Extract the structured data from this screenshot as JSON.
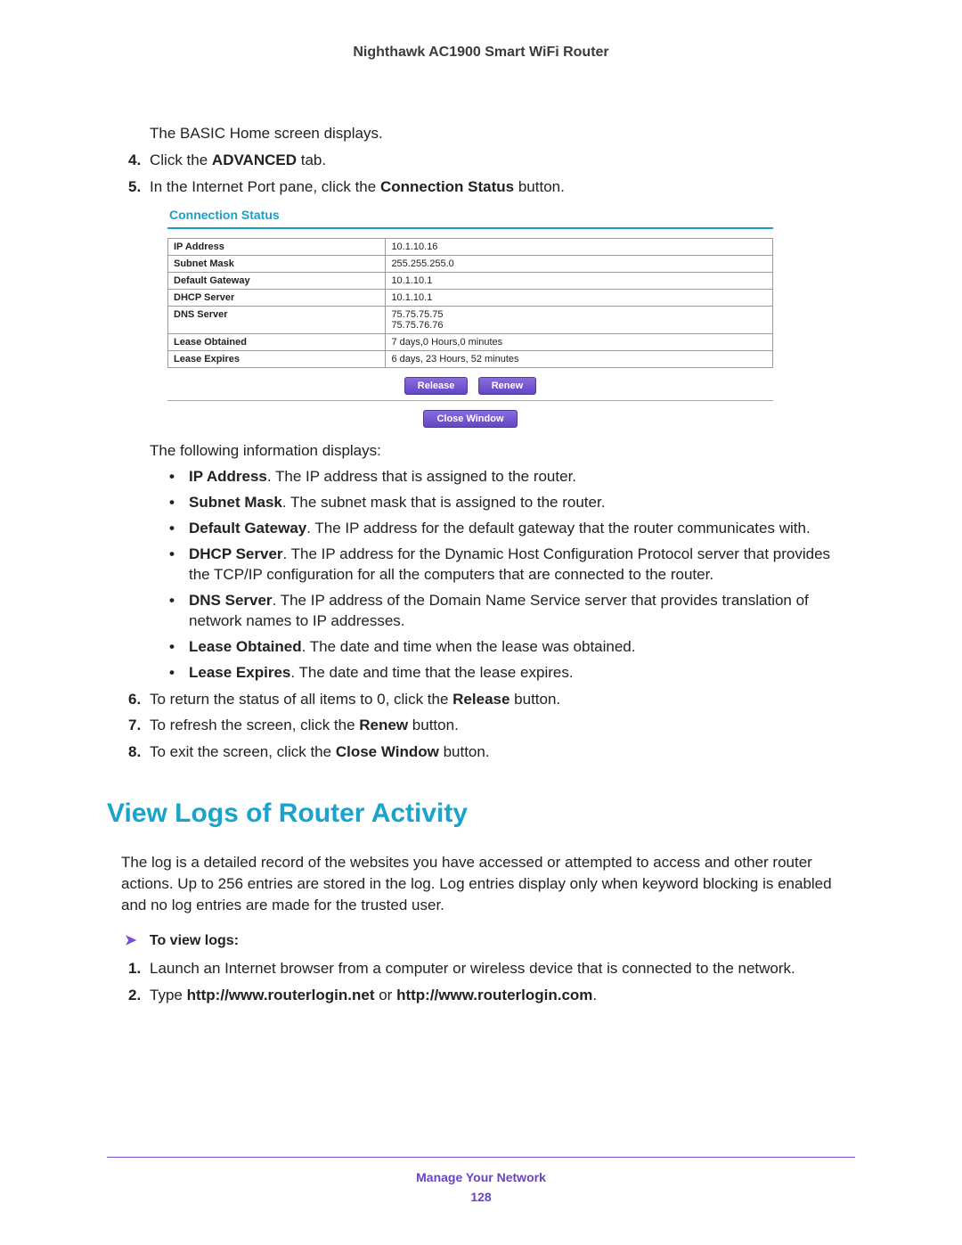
{
  "doc_title": "Nighthawk AC1900 Smart WiFi Router",
  "intro_line": "The BASIC Home screen displays.",
  "steps_a": [
    {
      "n": "4.",
      "pre": "Click the ",
      "bold": "ADVANCED",
      "post": " tab."
    },
    {
      "n": "5.",
      "pre": "In the Internet Port pane, click the ",
      "bold": "Connection Status",
      "post": " button."
    }
  ],
  "panel": {
    "title": "Connection Status",
    "rows": [
      {
        "label": "IP Address",
        "value": "10.1.10.16"
      },
      {
        "label": "Subnet Mask",
        "value": "255.255.255.0"
      },
      {
        "label": "Default Gateway",
        "value": "10.1.10.1"
      },
      {
        "label": "DHCP Server",
        "value": "10.1.10.1"
      },
      {
        "label": "DNS Server",
        "value": "75.75.75.75\n75.75.76.76"
      },
      {
        "label": "Lease Obtained",
        "value": "7 days,0 Hours,0 minutes"
      },
      {
        "label": "Lease Expires",
        "value": "6 days, 23 Hours, 52 minutes"
      }
    ],
    "buttons": {
      "release": "Release",
      "renew": "Renew",
      "close": "Close Window"
    }
  },
  "following_line": "The following information displays:",
  "bullets": [
    {
      "bold": "IP Address",
      "text": ". The IP address that is assigned to the router."
    },
    {
      "bold": "Subnet Mask",
      "text": ". The subnet mask that is assigned to the router."
    },
    {
      "bold": "Default Gateway",
      "text": ". The IP address for the default gateway that the router communicates with."
    },
    {
      "bold": "DHCP Server",
      "text": ". The IP address for the Dynamic Host Configuration Protocol server that provides the TCP/IP configuration for all the computers that are connected to the router."
    },
    {
      "bold": "DNS Server",
      "text": ". The IP address of the Domain Name Service server that provides translation of network names to IP addresses."
    },
    {
      "bold": "Lease Obtained",
      "text": ". The date and time when the lease was obtained."
    },
    {
      "bold": "Lease Expires",
      "text": ". The date and time that the lease expires."
    }
  ],
  "steps_b": [
    {
      "n": "6.",
      "pre": "To return the status of all items to 0, click the ",
      "bold": "Release",
      "post": " button."
    },
    {
      "n": "7.",
      "pre": "To refresh the screen, click the ",
      "bold": "Renew",
      "post": " button."
    },
    {
      "n": "8.",
      "pre": "To exit the screen, click the ",
      "bold": "Close Window",
      "post": " button."
    }
  ],
  "section_heading": "View Logs of Router Activity",
  "section_intro": "The log is a detailed record of the websites you have accessed or attempted to access and other router actions. Up to 256 entries are stored in the log. Log entries display only when keyword blocking is enabled and no log entries are made for the trusted user.",
  "subhead": "To view logs:",
  "steps_c": [
    {
      "n": "1.",
      "text": "Launch an Internet browser from a computer or wireless device that is connected to the network."
    },
    {
      "n": "2.",
      "pre": "Type ",
      "bold1": "http://www.routerlogin.net",
      "mid": " or ",
      "bold2": "http://www.routerlogin.com",
      "post": "."
    }
  ],
  "footer": {
    "section": "Manage Your Network",
    "page": "128"
  }
}
